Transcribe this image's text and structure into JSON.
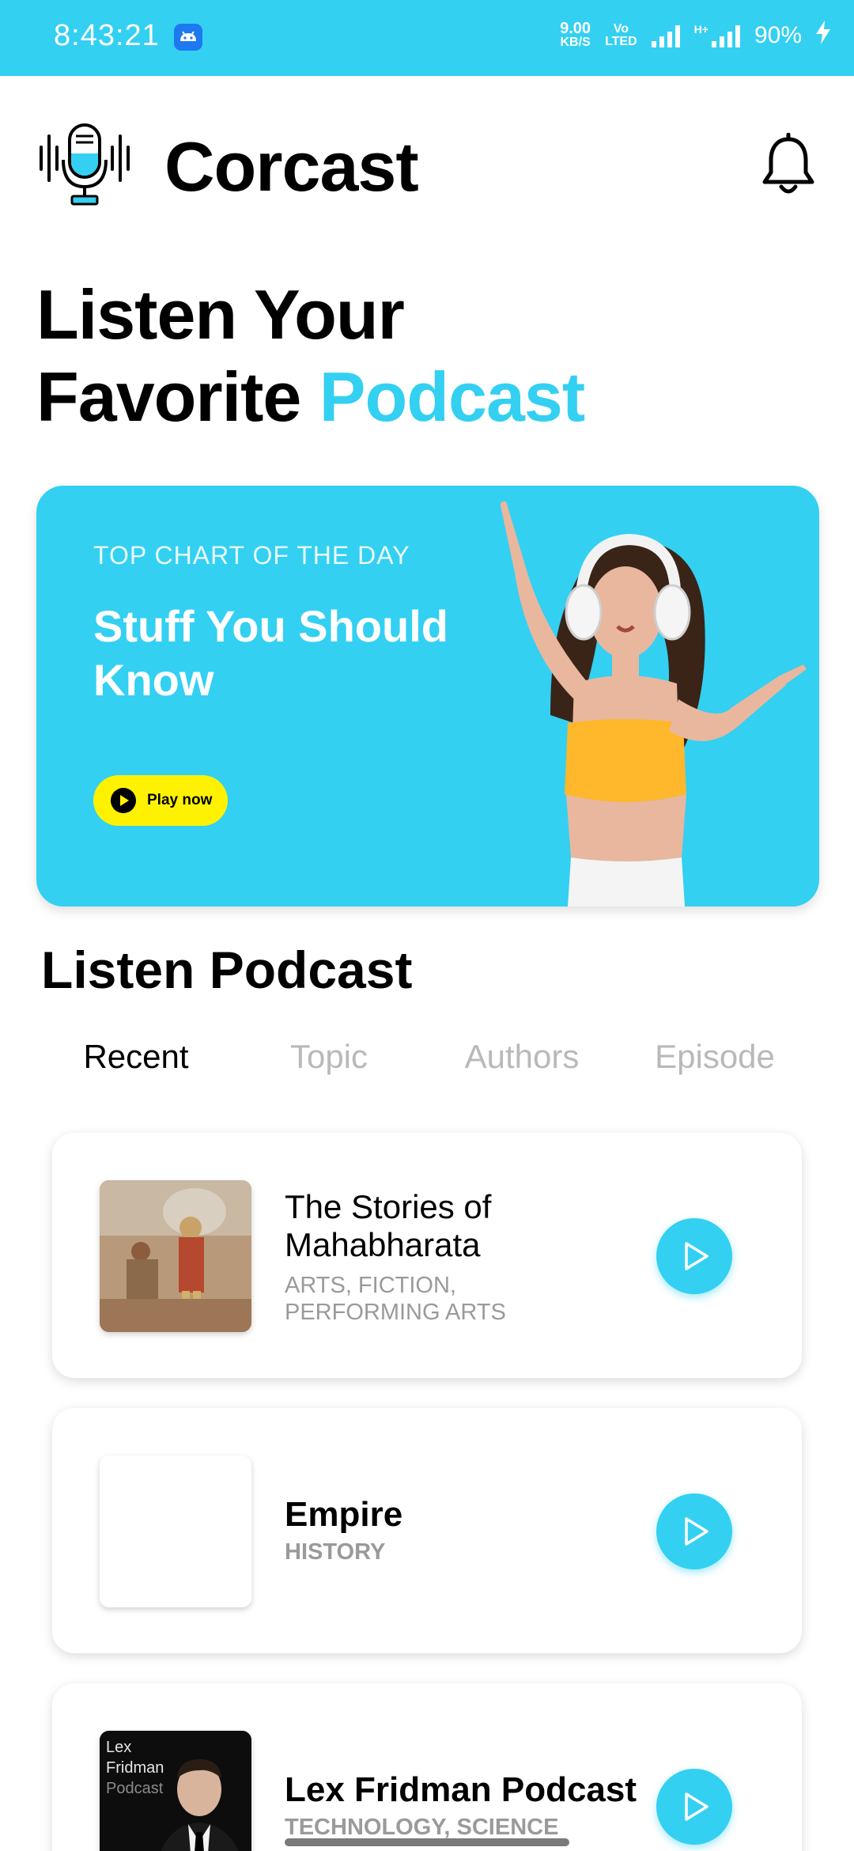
{
  "status_bar": {
    "time": "8:43:21",
    "net_speed_value": "9.00",
    "net_speed_unit": "KB/S",
    "volte_top": "Vo",
    "volte_bottom": "LTED",
    "network_type": "H+",
    "battery": "90%",
    "icons": [
      "android-notification-icon",
      "signal-icon",
      "signal-icon",
      "charging-bolt-icon"
    ]
  },
  "header": {
    "app_name": "Corcast",
    "logo_icon": "microphone-icon",
    "notification_icon": "bell-icon"
  },
  "hero": {
    "line1": "Listen Your",
    "line2_plain": "Favorite",
    "line2_accent": "Podcast"
  },
  "banner": {
    "kicker": "TOP CHART OF THE DAY",
    "title": "Stuff You Should Know",
    "button_label": "Play now",
    "button_icon": "play-circle-icon"
  },
  "section": {
    "title": "Listen Podcast",
    "tabs": [
      {
        "label": "Recent",
        "active": true
      },
      {
        "label": "Topic",
        "active": false
      },
      {
        "label": "Authors",
        "active": false
      },
      {
        "label": "Episode",
        "active": false
      }
    ]
  },
  "podcasts": [
    {
      "title": "The Stories of Mahabharata",
      "subtitle": "ARTS, FICTION, PERFORMING ARTS",
      "play_icon": "play-icon"
    },
    {
      "title": "Empire",
      "subtitle": "HISTORY",
      "play_icon": "play-icon"
    },
    {
      "title": "Lex Fridman Podcast",
      "subtitle": "TECHNOLOGY, SCIENCE",
      "play_icon": "play-icon",
      "thumb_lines": [
        "Lex",
        "Fridman",
        "Podcast"
      ]
    }
  ],
  "colors": {
    "accent": "#33d0f2",
    "button_yellow": "#fff200",
    "inactive_tab": "#b9b9b9"
  }
}
